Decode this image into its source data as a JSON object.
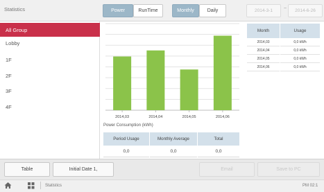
{
  "header": {
    "title": "Statistics",
    "type_tabs": [
      {
        "label": "Power",
        "active": true
      },
      {
        "label": "RunTime",
        "active": false
      }
    ],
    "period_tabs": [
      {
        "label": "Monthly",
        "active": true
      },
      {
        "label": "Daily",
        "active": false
      }
    ],
    "date_from": "2014-3-1",
    "date_sep": "~",
    "date_to": "2014-6-26"
  },
  "sidebar": {
    "items": [
      {
        "label": "All Group",
        "selected": true
      },
      {
        "label": "Lobby",
        "selected": false
      },
      {
        "label": "1F",
        "selected": false
      },
      {
        "label": "2F",
        "selected": false
      },
      {
        "label": "3F",
        "selected": false
      },
      {
        "label": "4F",
        "selected": false
      }
    ]
  },
  "chart_data": {
    "type": "bar",
    "categories": [
      "2014,03",
      "2014,04",
      "2014,05",
      "2014,06"
    ],
    "values": [
      0.62,
      0.69,
      0.47,
      0.86
    ],
    "ylim": [
      0,
      1
    ],
    "grid": true,
    "bar_color": "#8bc34a",
    "xlabel": "",
    "ylabel": "",
    "title": ""
  },
  "chart_caption": "Power Consumption (kWh)",
  "summary": {
    "headers": [
      "Period Usage",
      "Monthly Average",
      "Total"
    ],
    "values": [
      "0,0",
      "0,0",
      "0,0"
    ]
  },
  "usage_table": {
    "headers": [
      "Month",
      "Usage"
    ],
    "rows": [
      {
        "month": "2014,03",
        "usage": "0,0 kWh"
      },
      {
        "month": "2014,04",
        "usage": "0,0 kWh"
      },
      {
        "month": "2014,05",
        "usage": "0,0 kWh"
      },
      {
        "month": "2014,06",
        "usage": "0,0 kWh"
      }
    ]
  },
  "actions": {
    "table": "Table",
    "initial_date": "Initial Date 1,",
    "email": "Email",
    "save_to_pc": "Save to PC"
  },
  "status": {
    "breadcrumb": "Statistics",
    "time": "PM 02:1"
  },
  "colors": {
    "accent": "#c9304a",
    "active_tab": "#9cb7c8",
    "table_header": "#d3e0ea"
  }
}
